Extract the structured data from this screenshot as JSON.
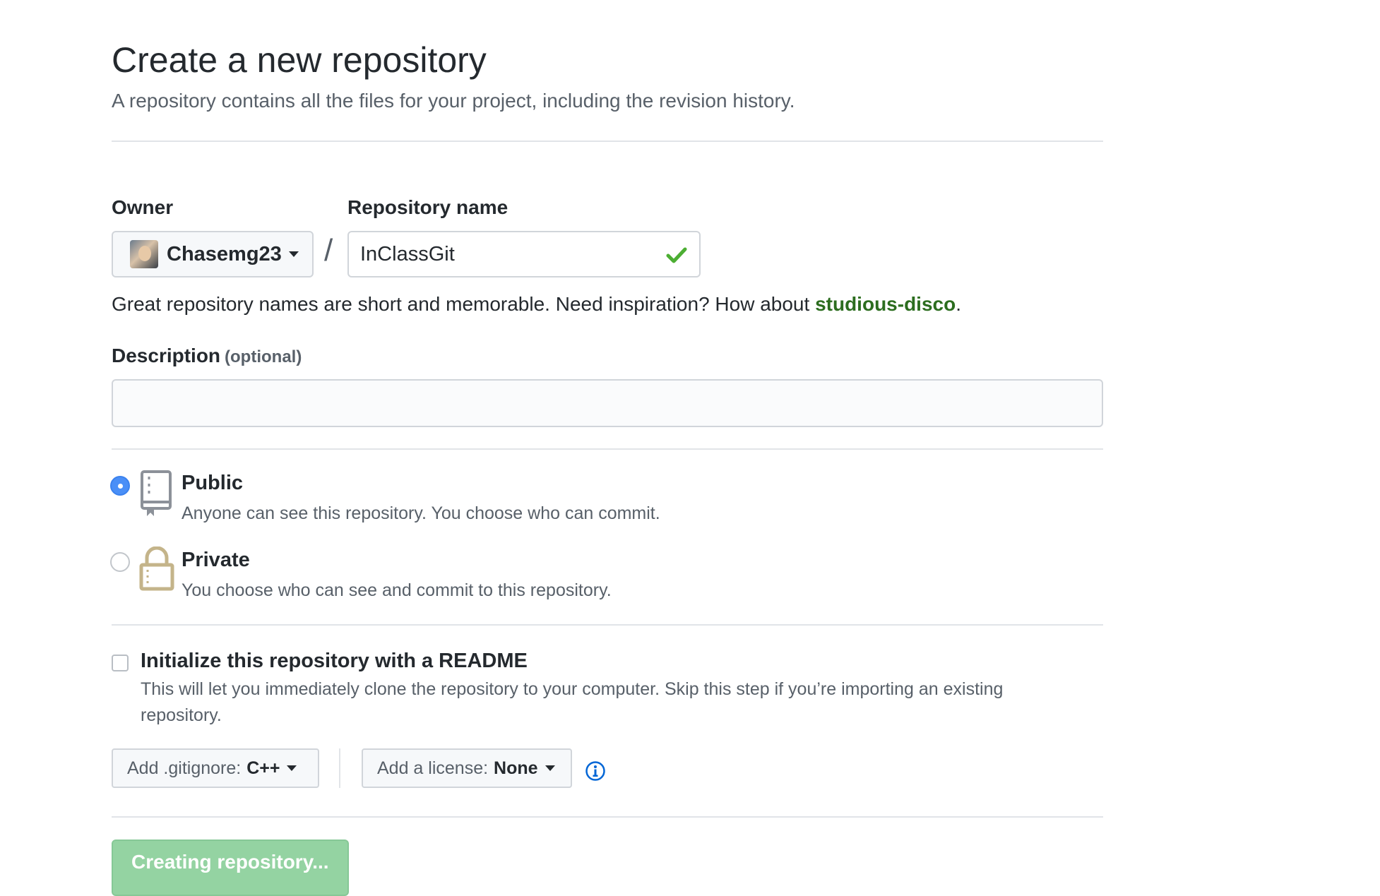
{
  "header": {
    "title": "Create a new repository",
    "subtitle": "A repository contains all the files for your project, including the revision history."
  },
  "owner": {
    "label": "Owner",
    "value": "Chasemg23"
  },
  "separator": "/",
  "repository_name": {
    "label": "Repository name",
    "value": "InClassGit",
    "valid": true
  },
  "name_hint": {
    "prefix": "Great repository names are short and memorable. Need inspiration? How about ",
    "suggestion": "studious-disco",
    "suffix": "."
  },
  "description": {
    "label": "Description",
    "optional": "(optional)",
    "value": ""
  },
  "visibility": {
    "selected": "public",
    "public": {
      "title": "Public",
      "description": "Anyone can see this repository. You choose who can commit.",
      "icon": "repo-icon"
    },
    "private": {
      "title": "Private",
      "description": "You choose who can see and commit to this repository.",
      "icon": "lock-icon"
    }
  },
  "readme": {
    "checked": false,
    "title": "Initialize this repository with a README",
    "description": "This will let you immediately clone the repository to your computer. Skip this step if you’re importing an existing repository."
  },
  "gitignore": {
    "label": "Add .gitignore:",
    "value": "C++"
  },
  "license": {
    "label": "Add a license:",
    "value": "None"
  },
  "submit": {
    "label": "Creating repository..."
  },
  "colors": {
    "accent_green": "#2c6d1f",
    "check_green": "#4cae33",
    "radio_blue": "#4a8ff7",
    "button_green_disabled": "#94d3a2",
    "info_blue": "#0366d6"
  }
}
